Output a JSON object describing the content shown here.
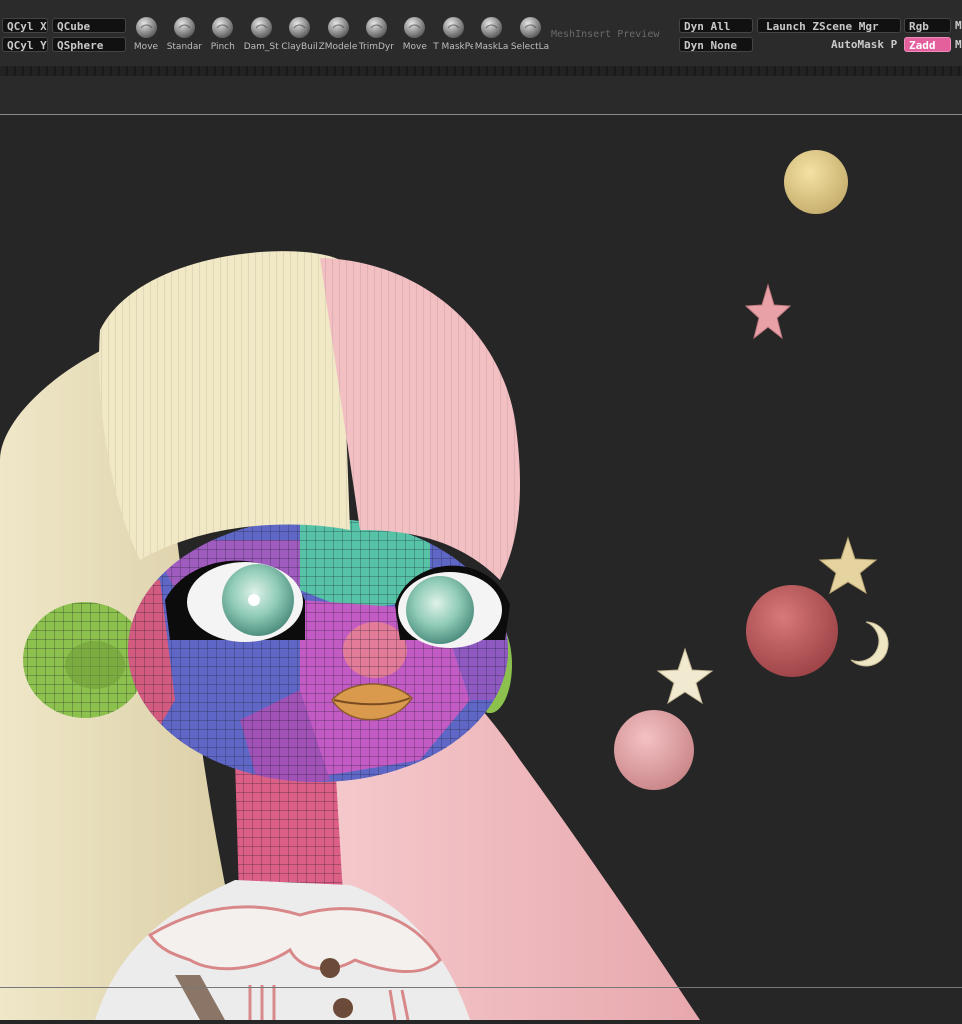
{
  "quick_shapes": {
    "qcyl_x": "QCyl X",
    "qcube": "QCube",
    "qcyl_y": "QCyl Y",
    "qsphere": "QSphere"
  },
  "brushes": [
    {
      "label": "Move",
      "icon": "move-brush-icon"
    },
    {
      "label": "Standar",
      "icon": "standard-brush-icon"
    },
    {
      "label": "Pinch",
      "icon": "pinch-brush-icon"
    },
    {
      "label": "Dam_St",
      "icon": "damstandard-brush-icon"
    },
    {
      "label": "ClayBuil",
      "icon": "claybuildup-brush-icon"
    },
    {
      "label": "ZModele",
      "icon": "zmodeler-brush-icon"
    },
    {
      "label": "TrimDyr",
      "icon": "trimdynamic-brush-icon"
    },
    {
      "label": "Move",
      "icon": "move-topological-brush-icon"
    },
    {
      "label": "T MaskPe",
      "icon": "maskpen-brush-icon"
    },
    {
      "label": "MaskLa",
      "icon": "masklasso-brush-icon"
    },
    {
      "label": "SelectLa",
      "icon": "selectlasso-brush-icon"
    }
  ],
  "mesh_insert_preview": "MeshInsert Preview",
  "dynamic": {
    "dyn_all": "Dyn All",
    "dyn_none": "Dyn None",
    "launch_zscene": "Launch ZScene Mgr"
  },
  "automask": "AutoMask P",
  "rgb": "Rgb",
  "zadd": "Zadd",
  "edge_m1": "M",
  "edge_m2": "M",
  "colors": {
    "accent": "#e3609d",
    "background": "#262626",
    "toolbar": "#2b2b2b"
  }
}
